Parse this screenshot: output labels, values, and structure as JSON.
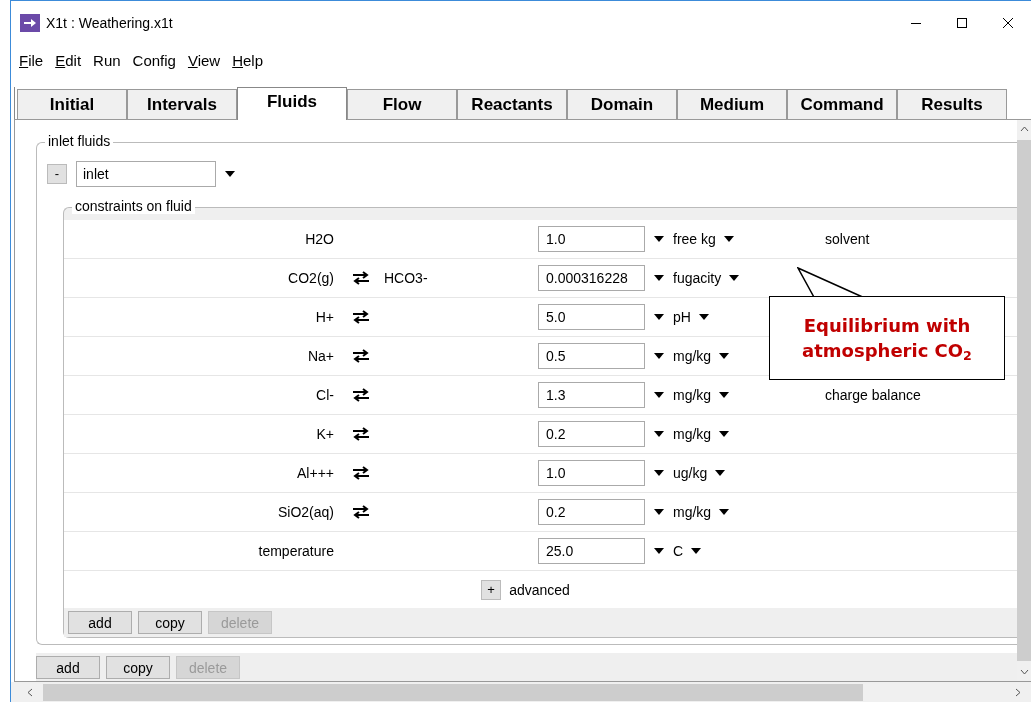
{
  "window": {
    "title": "X1t : Weathering.x1t"
  },
  "menu": [
    {
      "label": "File",
      "underline_first": true
    },
    {
      "label": "Edit",
      "underline_first": true
    },
    {
      "label": "Run",
      "underline_first": false
    },
    {
      "label": "Config",
      "underline_first": false
    },
    {
      "label": "View",
      "underline_first": true
    },
    {
      "label": "Help",
      "underline_first": true
    }
  ],
  "tabs": [
    {
      "label": "Initial",
      "selected": false
    },
    {
      "label": "Intervals",
      "selected": false
    },
    {
      "label": "Fluids",
      "selected": true
    },
    {
      "label": "Flow",
      "selected": false
    },
    {
      "label": "Reactants",
      "selected": false
    },
    {
      "label": "Domain",
      "selected": false
    },
    {
      "label": "Medium",
      "selected": false
    },
    {
      "label": "Command",
      "selected": false
    },
    {
      "label": "Results",
      "selected": false
    }
  ],
  "inlet_fluids": {
    "legend": "inlet fluids",
    "collapse_button": "-",
    "fluid": "inlet",
    "constraints": {
      "legend": "constraints on fluid",
      "rows": [
        {
          "species": "H2O",
          "swap": false,
          "value": "1.0",
          "unit": "free kg",
          "note": "solvent"
        },
        {
          "species": "CO2(g)",
          "swap": true,
          "alt_species": "HCO3-",
          "value": "0.000316228",
          "unit": "fugacity"
        },
        {
          "species": "H+",
          "swap": true,
          "value": "5.0",
          "unit": "pH"
        },
        {
          "species": "Na+",
          "swap": true,
          "value": "0.5",
          "unit": "mg/kg"
        },
        {
          "species": "Cl-",
          "swap": true,
          "value": "1.3",
          "unit": "mg/kg",
          "note": "charge balance"
        },
        {
          "species": "K+",
          "swap": true,
          "value": "0.2",
          "unit": "mg/kg"
        },
        {
          "species": "Al+++",
          "swap": true,
          "value": "1.0",
          "unit": "ug/kg"
        },
        {
          "species": "SiO2(aq)",
          "swap": true,
          "value": "0.2",
          "unit": "mg/kg"
        },
        {
          "species": "temperature",
          "swap": false,
          "value": "25.0",
          "unit": "C"
        }
      ],
      "advanced": {
        "button": "+",
        "label": "advanced"
      },
      "buttons": [
        {
          "label": "add",
          "disabled": false
        },
        {
          "label": "copy",
          "disabled": false
        },
        {
          "label": "delete",
          "disabled": true
        }
      ]
    },
    "buttons": [
      {
        "label": "add",
        "disabled": false
      },
      {
        "label": "copy",
        "disabled": false
      },
      {
        "label": "delete",
        "disabled": true
      }
    ]
  },
  "callout": {
    "text": "Equilibrium with atmospheric CO$_{2}$"
  }
}
